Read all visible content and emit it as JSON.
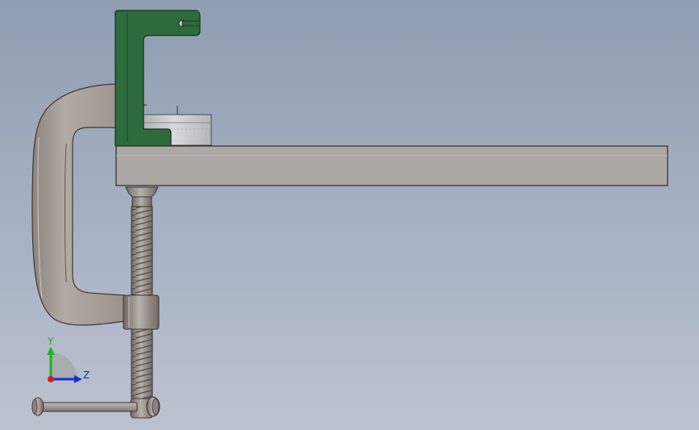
{
  "viewport": {
    "background_top": "#8f9db2",
    "background_bottom": "#bcc3cf"
  },
  "model": {
    "components": [
      {
        "name": "c-clamp-frame",
        "color": "#a39a94"
      },
      {
        "name": "bracket",
        "color": "#2e6b3c"
      },
      {
        "name": "dial-disc",
        "color": "#c6c7c9"
      },
      {
        "name": "flat-bar",
        "color": "#aca8a4"
      },
      {
        "name": "clamp-screw",
        "color": "#9a938d"
      },
      {
        "name": "t-handle",
        "color": "#9a938d"
      }
    ]
  },
  "triad": {
    "y_label": "Y",
    "z_label": "Z",
    "y_color": "#1db31d",
    "z_color": "#1a2fd0",
    "x_color": "#d02020"
  }
}
